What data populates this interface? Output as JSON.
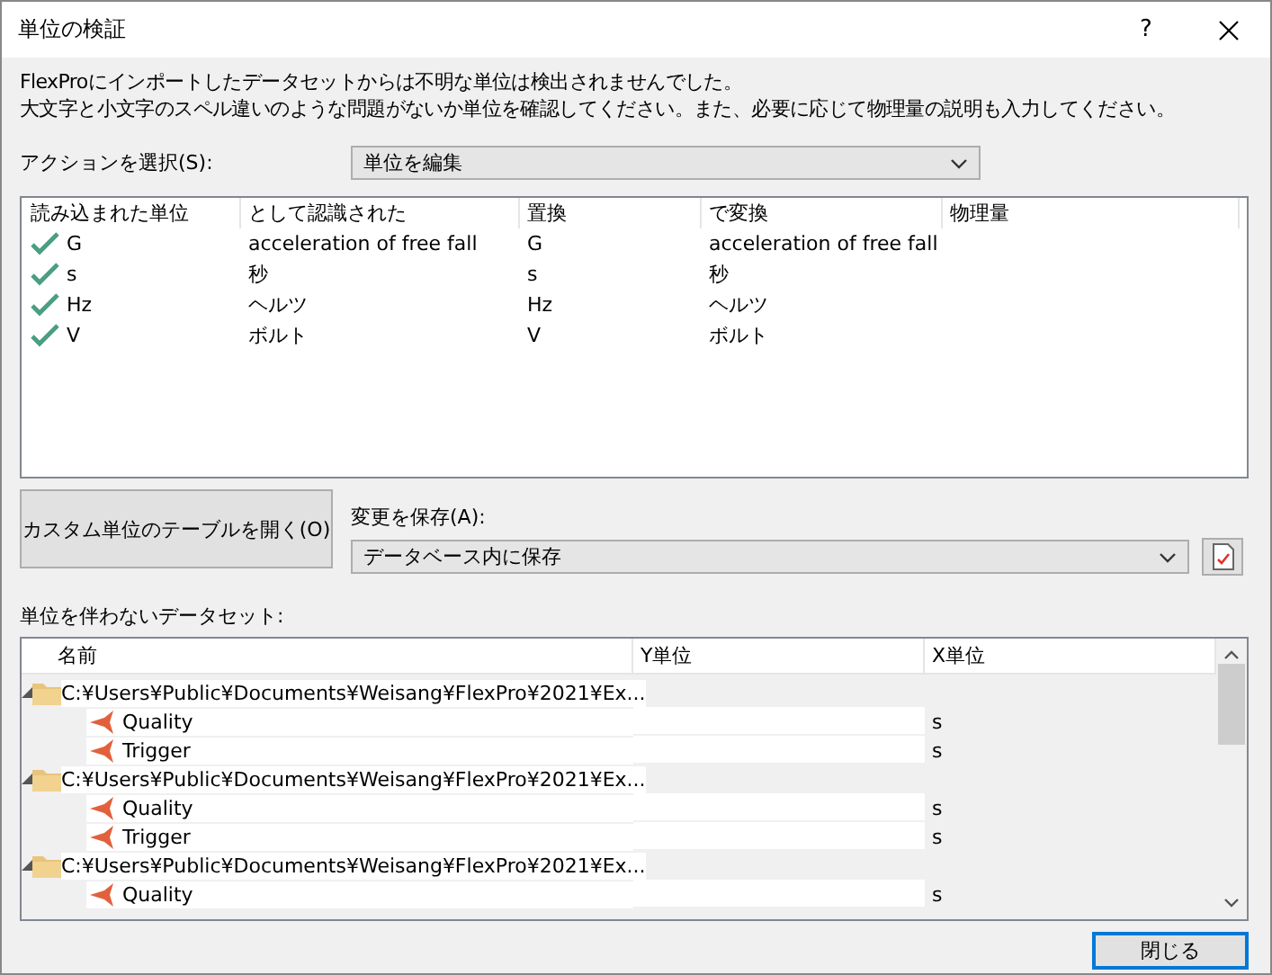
{
  "window": {
    "title": "単位の検証",
    "help_label": "?"
  },
  "message": [
    "FlexProにインポートしたデータセットからは不明な単位は検出されませんでした。",
    "大文字と小文字のスペル違いのような問題がないか単位を確認してください。また、必要に応じて物理量の説明も入力してください。"
  ],
  "action": {
    "label": "アクションを選択(S):",
    "value": "単位を編集"
  },
  "units_table": {
    "columns": [
      "読み込まれた単位",
      "として認識された",
      "置換",
      "で変換",
      "物理量"
    ],
    "rows": [
      {
        "valid": true,
        "cells": [
          "G",
          "acceleration of free fall",
          "G",
          "acceleration of free fall",
          ""
        ]
      },
      {
        "valid": true,
        "cells": [
          "s",
          "秒",
          "s",
          "秒",
          ""
        ]
      },
      {
        "valid": true,
        "cells": [
          "Hz",
          "ヘルツ",
          "Hz",
          "ヘルツ",
          ""
        ]
      },
      {
        "valid": true,
        "cells": [
          "V",
          "ボルト",
          "V",
          "ボルト",
          ""
        ]
      }
    ]
  },
  "custom_table_button": "カスタム単位のテーブルを開く(O)",
  "save": {
    "label": "変更を保存(A):",
    "value": "データベース内に保存"
  },
  "datasets": {
    "label": "単位を伴わないデータセット:",
    "columns": [
      "名前",
      "Y単位",
      "X単位"
    ],
    "items": [
      {
        "name": "C:¥Users¥Public¥Documents¥Weisang¥FlexPro¥2021¥Ex...",
        "expanded": true,
        "children": [
          {
            "name": "Quality",
            "x_unit": "s"
          },
          {
            "name": "Trigger",
            "x_unit": "s"
          }
        ]
      },
      {
        "name": "C:¥Users¥Public¥Documents¥Weisang¥FlexPro¥2021¥Ex...",
        "expanded": true,
        "children": [
          {
            "name": "Quality",
            "x_unit": "s"
          },
          {
            "name": "Trigger",
            "x_unit": "s"
          }
        ]
      },
      {
        "name": "C:¥Users¥Public¥Documents¥Weisang¥FlexPro¥2021¥Ex...",
        "expanded": true,
        "children": [
          {
            "name": "Quality",
            "x_unit": "s"
          }
        ]
      }
    ]
  },
  "close_button": "閉じる"
}
